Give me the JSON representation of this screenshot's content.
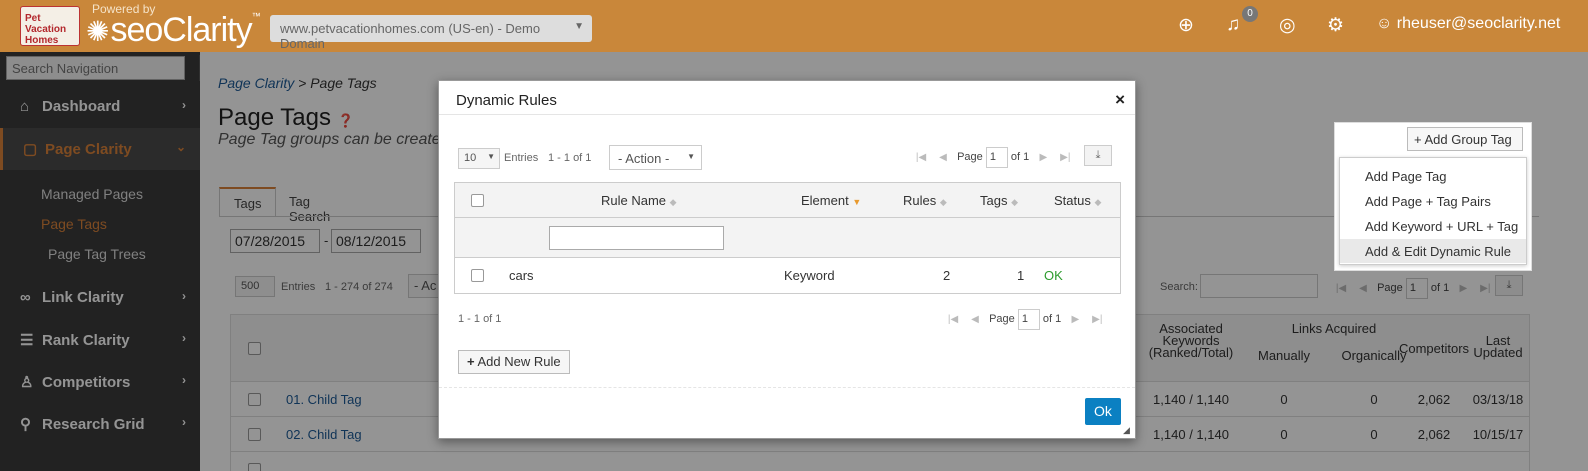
{
  "topbar": {
    "logo_text": "Pet Vacation Homes",
    "powered_by": "Powered by",
    "brand": "seoClarity",
    "domain": "www.petvacationhomes.com (US-en) - Demo Domain",
    "notification_count": "0",
    "user": "rheuser@seoclarity.net"
  },
  "sidebar": {
    "search_placeholder": "Search Navigation",
    "items": [
      {
        "label": "Dashboard",
        "icon": "home-icon"
      },
      {
        "label": "Page Clarity",
        "icon": "page-icon"
      },
      {
        "label": "Link Clarity",
        "icon": "link-icon"
      },
      {
        "label": "Rank Clarity",
        "icon": "list-icon"
      },
      {
        "label": "Competitors",
        "icon": "competitors-icon"
      },
      {
        "label": "Research Grid",
        "icon": "search-icon"
      }
    ],
    "sub_items": [
      "Managed Pages",
      "Page Tags",
      "Page Tag Trees"
    ]
  },
  "main": {
    "breadcrumb_link": "Page Clarity",
    "breadcrumb_current": "> Page Tags",
    "title": "Page Tags",
    "subtitle": "Page Tag groups can be created",
    "tabs": [
      "Tags",
      "Tag Search"
    ],
    "date_from": "07/28/2015",
    "date_to": "08/12/2015",
    "page_size": "500",
    "entries_label": "Entries",
    "range": "1 - 274 of 274",
    "action_label": "- Ac",
    "search_label": "Search:",
    "pager_page": "Page",
    "pager_value": "1",
    "pager_of": "of 1",
    "headers": {
      "assoc_keywords": "Associated Keywords (Ranked/Total)",
      "links_acquired": "Links Acquired",
      "manually": "Manually",
      "organically": "Organically",
      "competitors": "Competitors",
      "last_updated": "Last Updated"
    },
    "rows": [
      {
        "name": "01. Child Tag",
        "keywords": "1,140 / 1,140",
        "manually": "0",
        "organically": "0",
        "competitors": "2,062",
        "updated": "03/13/18"
      },
      {
        "name": "02. Child Tag",
        "keywords": "1,140 / 1,140",
        "manually": "0",
        "organically": "0",
        "competitors": "2,062",
        "updated": "10/15/17"
      }
    ]
  },
  "dropdown": {
    "button_label": "+ Add Group Tag",
    "items": [
      "Add Page Tag",
      "Add Page + Tag Pairs",
      "Add Keyword + URL + Tag",
      "Add & Edit Dynamic Rule"
    ]
  },
  "modal": {
    "title": "Dynamic Rules",
    "close": "×",
    "page_size": "10",
    "entries_label": "Entries",
    "range": "1 - 1 of 1",
    "action": "- Action -",
    "pager_page": "Page",
    "pager_value": "1",
    "pager_of": "of 1",
    "columns": [
      "Rule Name",
      "Element",
      "Rules",
      "Tags",
      "Status"
    ],
    "rows": [
      {
        "rule_name": "cars",
        "element": "Keyword",
        "rules": "2",
        "tags": "1",
        "status": "OK"
      }
    ],
    "footer_range": "1 - 1 of 1",
    "add_rule_label": "Add New Rule",
    "ok_label": "Ok"
  },
  "colors": {
    "topbar": "#c9873a",
    "sidebar": "#3c3c3c",
    "accent": "#d9823a",
    "ok_button": "#0b80c2",
    "status_ok": "#2d9b2d"
  }
}
